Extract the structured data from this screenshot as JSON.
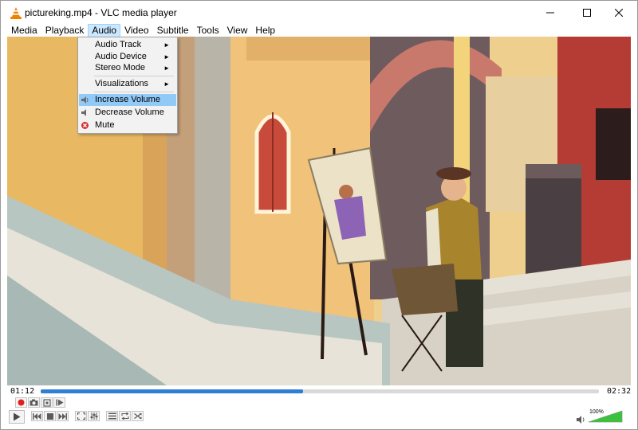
{
  "window": {
    "title": "pictureking.mp4 - VLC media player"
  },
  "icons": {
    "app": "vlc-cone-icon",
    "minimize": "minimize-icon",
    "maximize": "maximize-icon",
    "close": "close-icon"
  },
  "menubar": {
    "items": [
      {
        "label": "Media"
      },
      {
        "label": "Playback"
      },
      {
        "label": "Audio"
      },
      {
        "label": "Video"
      },
      {
        "label": "Subtitle"
      },
      {
        "label": "Tools"
      },
      {
        "label": "View"
      },
      {
        "label": "Help"
      }
    ],
    "active": "Audio"
  },
  "audio_menu": {
    "items": [
      {
        "label": "Audio Track",
        "submenu": true
      },
      {
        "label": "Audio Device",
        "submenu": true
      },
      {
        "label": "Stereo Mode",
        "submenu": true
      },
      {
        "label": "Visualizations",
        "submenu": true
      },
      {
        "label": "Increase Volume",
        "icon": "volume-up-icon",
        "highlighted": true
      },
      {
        "label": "Decrease Volume",
        "icon": "volume-down-icon"
      },
      {
        "label": "Mute",
        "icon": "mute-icon"
      }
    ]
  },
  "playback": {
    "elapsed": "01:12",
    "total": "02:32",
    "progress": 0.47
  },
  "volume": {
    "percent": "100%",
    "level": 1.0
  },
  "colors": {
    "seek_fill": "#2f7fd6",
    "menu_highlight": "#91c9f7",
    "volume_green": "#3fbf3f",
    "record_red": "#e02020"
  }
}
